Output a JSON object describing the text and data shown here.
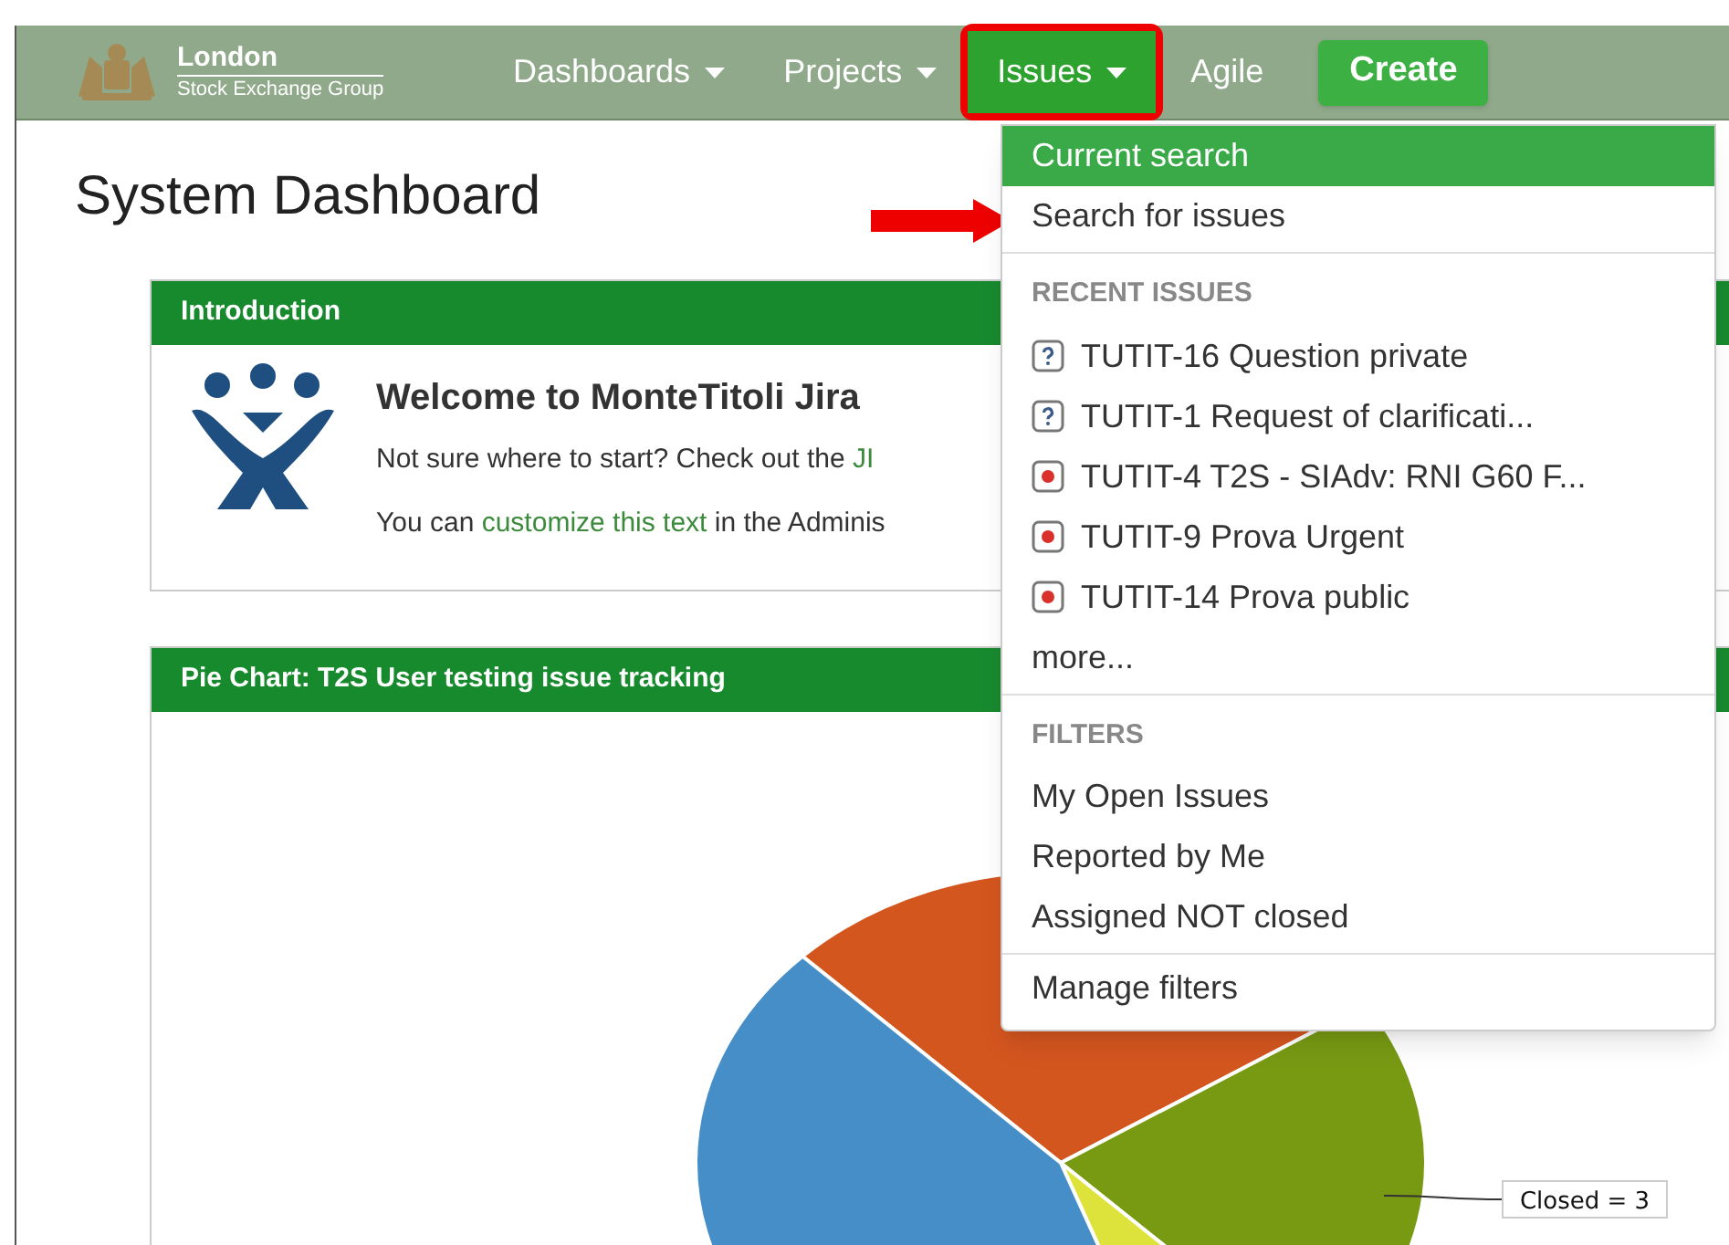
{
  "header": {
    "logo": {
      "title": "London",
      "subtitle": "Stock Exchange Group"
    },
    "nav": [
      {
        "label": "Dashboards",
        "dropdown": true,
        "selected": false
      },
      {
        "label": "Projects",
        "dropdown": true,
        "selected": false
      },
      {
        "label": "Issues",
        "dropdown": true,
        "selected": true
      },
      {
        "label": "Agile",
        "dropdown": false,
        "selected": false
      }
    ],
    "create_button": "Create"
  },
  "page_title": "System Dashboard",
  "introduction": {
    "title": "Introduction",
    "heading": "Welcome to MonteTitoli Jira",
    "line_1": {
      "text": "Not sure where to start? Check out the ",
      "link": "JI"
    },
    "line_2": {
      "before": "You can ",
      "link": "customize this text",
      "after": " in the Adminis"
    }
  },
  "pie_chart": {
    "title": "Pie Chart: T2S User testing issue tracking",
    "callout": "Closed = 3"
  },
  "issues_menu": {
    "items": [
      {
        "label": "Current search",
        "selected": true
      },
      {
        "label": "Search for issues",
        "selected": false
      }
    ],
    "recent_heading": "RECENT ISSUES",
    "recent_issues": [
      {
        "kind": "question",
        "label": "TUTIT-16 Question private"
      },
      {
        "kind": "question",
        "label": "TUTIT-1 Request of clarificati..."
      },
      {
        "kind": "bug",
        "label": "TUTIT-4 T2S - SIAdv: RNI G60 F..."
      },
      {
        "kind": "bug",
        "label": "TUTIT-9 Prova Urgent"
      },
      {
        "kind": "bug",
        "label": "TUTIT-14 Prova public"
      }
    ],
    "more": "more...",
    "filters_heading": "FILTERS",
    "filters": [
      "My Open Issues",
      "Reported by Me",
      "Assigned NOT closed"
    ],
    "manage": "Manage filters"
  }
}
